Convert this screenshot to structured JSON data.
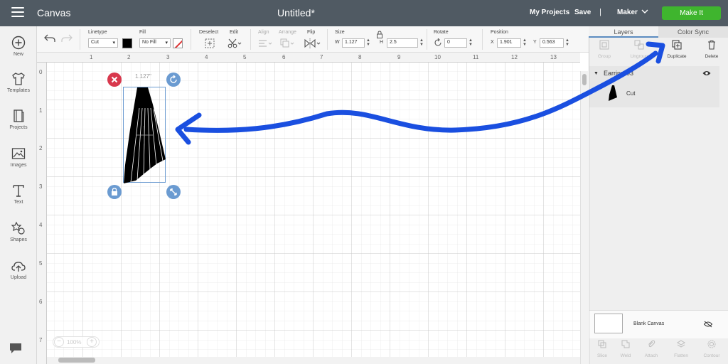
{
  "header": {
    "app_title": "Canvas",
    "doc_title": "Untitled*",
    "my_projects": "My Projects",
    "save": "Save",
    "separator": "|",
    "machine": "Maker",
    "make_it": "Make It"
  },
  "left_tools": [
    {
      "label": "New",
      "icon": "plus-circle-icon"
    },
    {
      "label": "Templates",
      "icon": "shirt-icon"
    },
    {
      "label": "Projects",
      "icon": "book-icon"
    },
    {
      "label": "Images",
      "icon": "image-icon"
    },
    {
      "label": "Text",
      "icon": "text-icon"
    },
    {
      "label": "Shapes",
      "icon": "shapes-icon"
    },
    {
      "label": "Upload",
      "icon": "cloud-upload-icon"
    }
  ],
  "toolbar": {
    "linetype_label": "Linetype",
    "linetype_value": "Cut",
    "fill_label": "Fill",
    "fill_value": "No Fill",
    "deselect_label": "Deselect",
    "edit_label": "Edit",
    "align_label": "Align",
    "arrange_label": "Arrange",
    "flip_label": "Flip",
    "size_label": "Size",
    "w_label": "W",
    "w_value": "1.127",
    "h_label": "H",
    "h_value": "2.5",
    "rotate_label": "Rotate",
    "rotate_value": "0",
    "position_label": "Position",
    "x_label": "X",
    "x_value": "1.901",
    "y_label": "Y",
    "y_value": "0.563"
  },
  "canvas": {
    "ruler_top": [
      "1",
      "2",
      "3",
      "4",
      "5",
      "6",
      "7",
      "8",
      "9",
      "10",
      "11",
      "12",
      "13"
    ],
    "ruler_left": [
      "0",
      "1",
      "2",
      "3",
      "4",
      "5",
      "6",
      "7"
    ],
    "width_label": "1.127\"",
    "zoom": "100%",
    "zoom_minus": "−",
    "zoom_plus": "+"
  },
  "layers_panel": {
    "tab_layers": "Layers",
    "tab_color_sync": "Color Sync",
    "tools": [
      {
        "label": "Group",
        "enabled": false
      },
      {
        "label": "Ungroup",
        "enabled": false
      },
      {
        "label": "Duplicate",
        "enabled": true
      },
      {
        "label": "Delete",
        "enabled": true
      }
    ],
    "group_name": "Earring-03",
    "item_label": "Cut",
    "blank_canvas": "Blank Canvas",
    "bottom_tools": [
      "Slice",
      "Weld",
      "Attach",
      "Flatten",
      "Contour"
    ]
  },
  "colors": {
    "topbar": "#505a63",
    "make_it": "#3fb52e",
    "annotation_arrow": "#1a4fe0",
    "delete_handle": "#d8384d",
    "handle": "#6b9bd1"
  }
}
